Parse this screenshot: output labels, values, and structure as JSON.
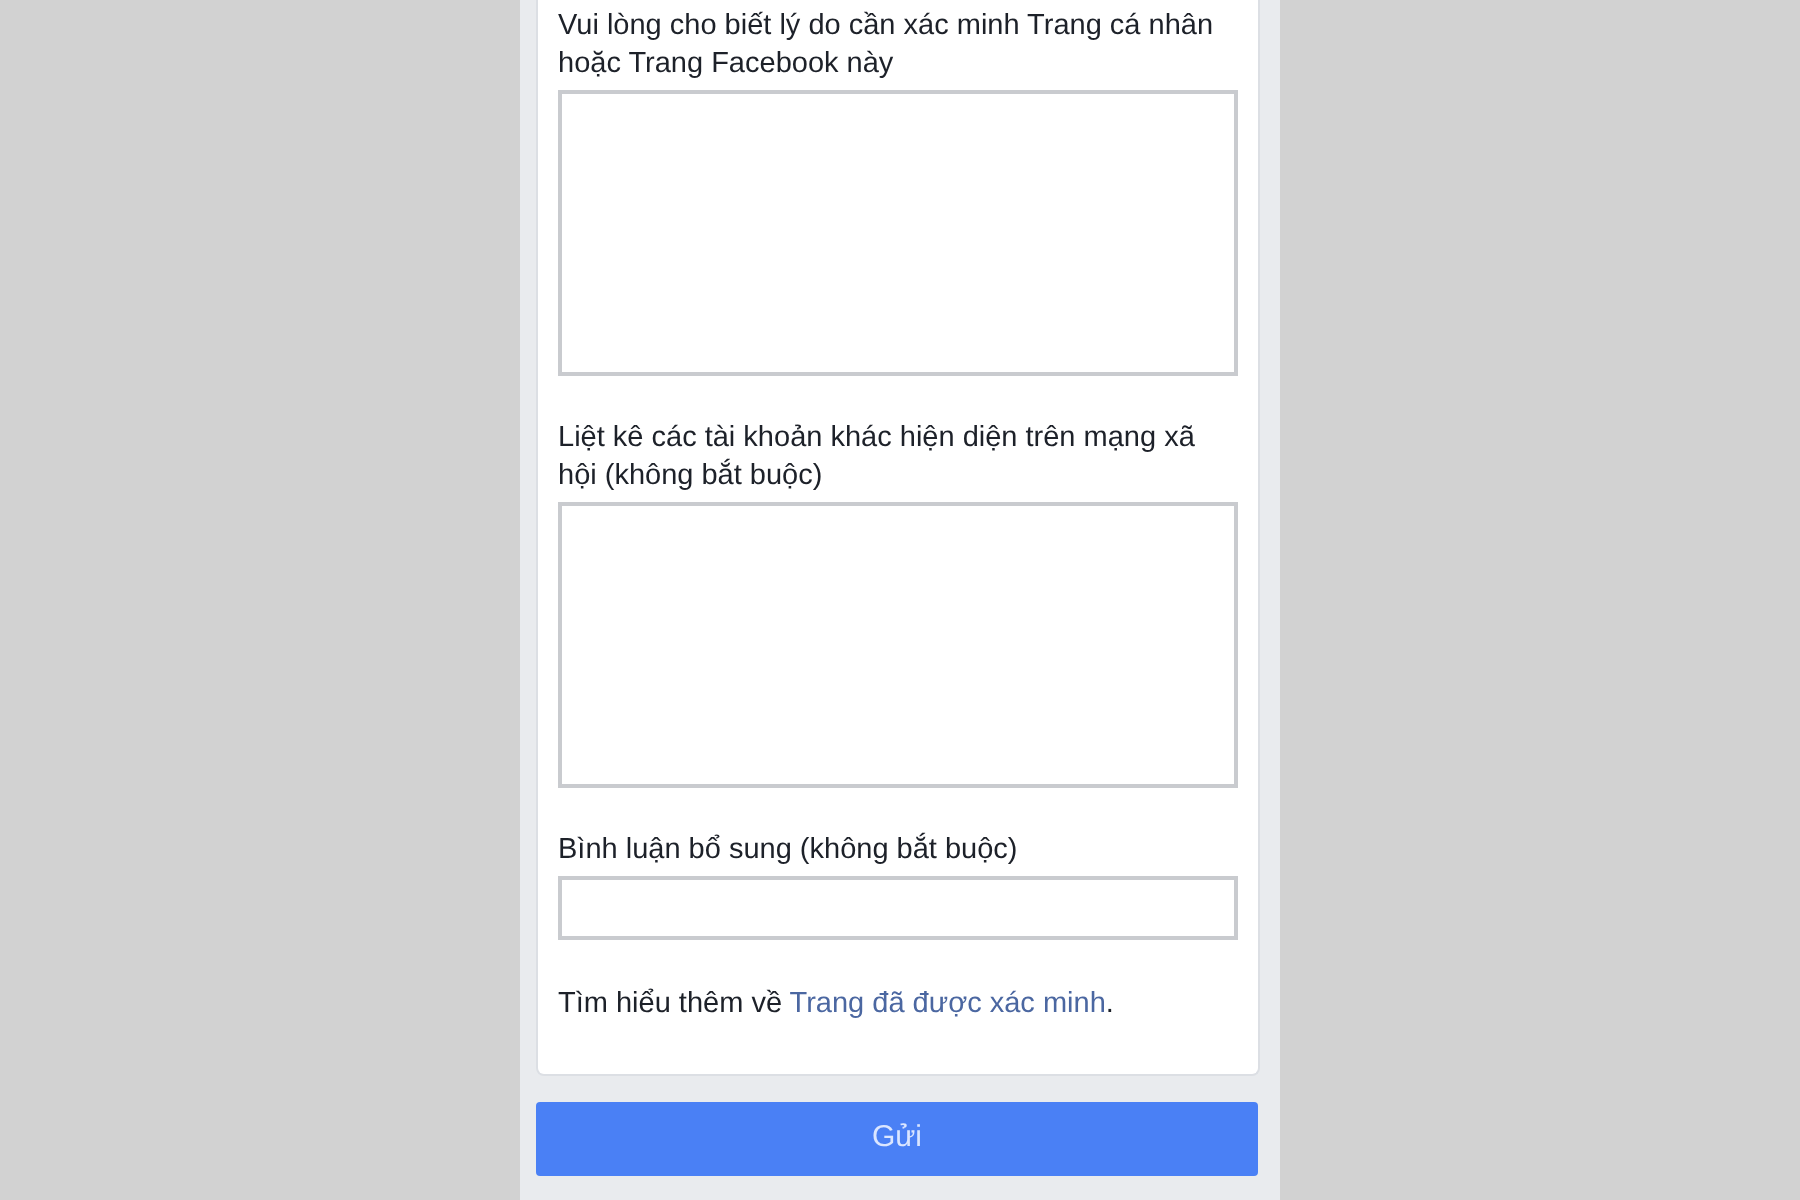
{
  "fields": [
    {
      "kind": "textarea",
      "label": "Vui lòng cho biết lý do cần xác minh Trang cá nhân hoặc Trang Facebook này"
    },
    {
      "kind": "textarea",
      "label": "Liệt kê các tài khoản khác hiện diện trên mạng xã hội (không bắt buộc)"
    },
    {
      "kind": "input",
      "label": "Bình luận bổ sung (không bắt buộc)"
    }
  ],
  "learn_more": {
    "text": "Tìm hiểu thêm về",
    "link": "Trang đã được xác minh",
    "trailing": "."
  },
  "submit_button": "Gửi"
}
